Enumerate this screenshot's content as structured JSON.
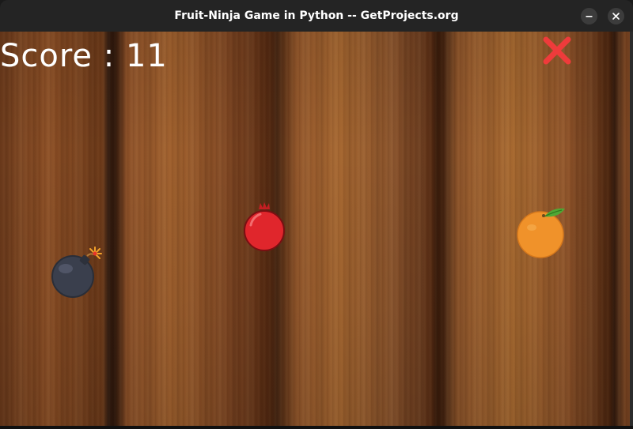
{
  "window": {
    "title": "Fruit-Ninja Game in Python -- GetProjects.org",
    "minimize_icon": "minimize-icon",
    "close_icon": "close-icon"
  },
  "game": {
    "score_text": "Score : 11",
    "lives_icon": "red-x-icon",
    "objects": [
      {
        "type": "bomb",
        "icon": "bomb-icon"
      },
      {
        "type": "pomegranate",
        "icon": "pomegranate-icon"
      },
      {
        "type": "orange",
        "icon": "orange-icon"
      }
    ],
    "colors": {
      "score": "#ffffff",
      "lives_x": "#ee3b3b",
      "bomb": "#3a3f4d",
      "pomegranate": "#e0262c",
      "orange": "#f0922a",
      "leaf": "#4fa836"
    }
  }
}
